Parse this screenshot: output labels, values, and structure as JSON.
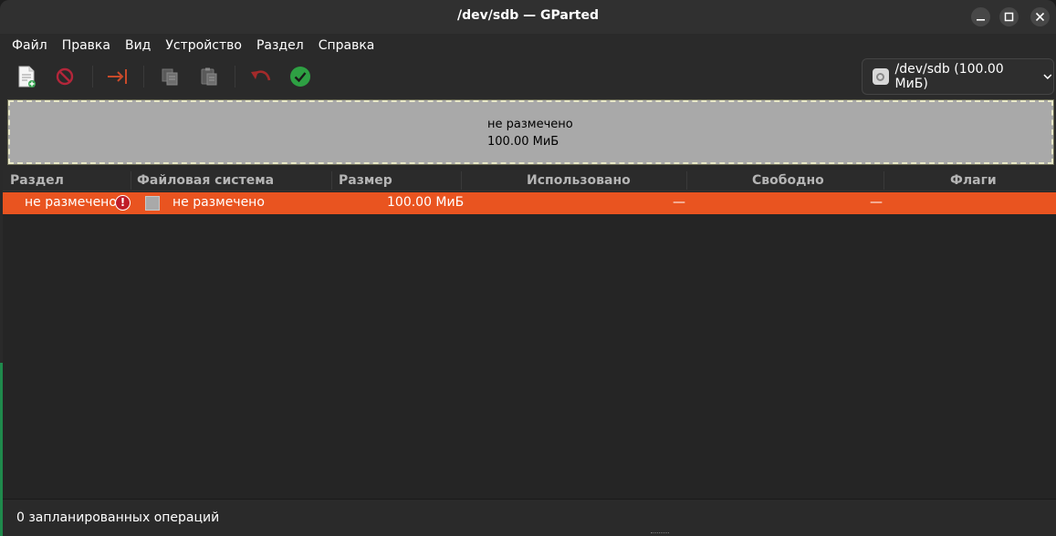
{
  "window": {
    "title": "/dev/sdb — GParted"
  },
  "menu": [
    {
      "label": "Файл"
    },
    {
      "label": "Правка"
    },
    {
      "label": "Вид"
    },
    {
      "label": "Устройство"
    },
    {
      "label": "Раздел"
    },
    {
      "label": "Справка"
    }
  ],
  "toolbar": {
    "new_icon": "new-partition-icon",
    "delete_icon": "delete-icon",
    "resize_icon": "resize-move-icon",
    "copy_icon": "copy-icon",
    "paste_icon": "paste-icon",
    "undo_icon": "undo-icon",
    "apply_icon": "apply-icon"
  },
  "device": {
    "label": "/dev/sdb (100.00 МиБ)"
  },
  "disk_graphic": {
    "label": "не размечено",
    "size": "100.00 МиБ"
  },
  "table": {
    "headers": {
      "partition": "Раздел",
      "filesystem": "Файловая система",
      "size": "Размер",
      "used": "Использовано",
      "free": "Свободно",
      "flags": "Флаги"
    },
    "rows": [
      {
        "partition": "не размечено",
        "filesystem": "не размечено",
        "size": "100.00 МиБ",
        "used": "—",
        "free": "—",
        "flags": ""
      }
    ],
    "error_glyph": "!"
  },
  "status": {
    "text": "0 запланированных операций"
  },
  "colors": {
    "selection": "#e95420",
    "unallocated": "#a9a9a9",
    "apply": "#2ea043",
    "error": "#c01c28"
  }
}
